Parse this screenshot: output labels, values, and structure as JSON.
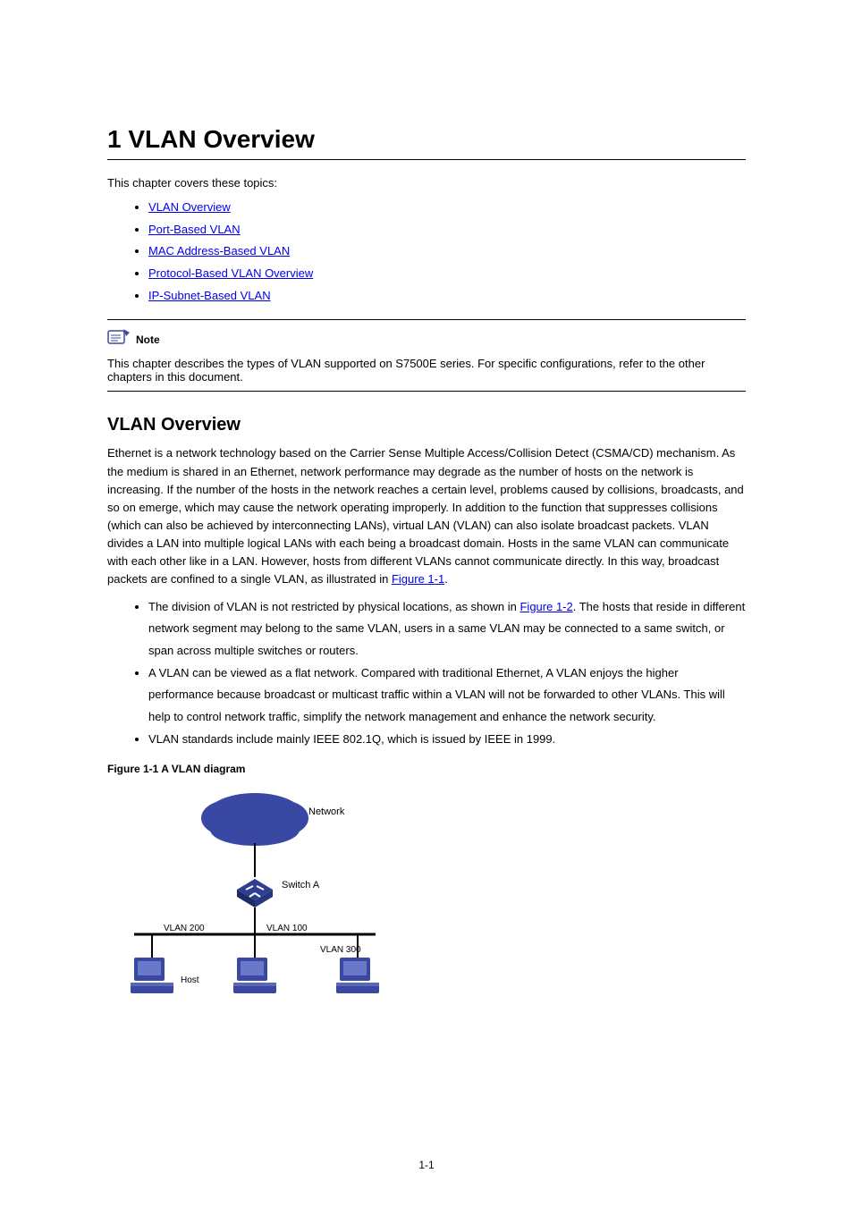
{
  "chapter": {
    "number": "1",
    "title": "VLAN Overview"
  },
  "intro": "This chapter covers these topics:",
  "toc": [
    {
      "label": "VLAN Overview"
    },
    {
      "label": "Port-Based VLAN"
    },
    {
      "label": "MAC Address-Based VLAN"
    },
    {
      "label": "Protocol-Based VLAN Overview"
    },
    {
      "label": "IP-Subnet-Based VLAN"
    }
  ],
  "note": {
    "label": "Note",
    "text": "This chapter describes the types of VLAN supported on S7500E series. For specific configurations, refer to the other chapters in this document."
  },
  "section": {
    "title": "VLAN Overview"
  },
  "para1_a": "Ethernet is a network technology based on the Carrier Sense Multiple Access/Collision Detect (CSMA/CD) mechanism. As the medium is shared in an Ethernet, network performance may degrade as the number of hosts on the network is increasing. If the number of the hosts in the network reaches a certain level, problems caused by collisions, broadcasts, and so on emerge, which may cause the network operating improperly. In addition to the function that suppresses collisions (which can also be achieved by interconnecting LANs), virtual LAN (VLAN) can also isolate broadcast packets. VLAN divides a LAN into multiple logical LANs with each being a broadcast domain. Hosts in the same VLAN can communicate with each other like in a LAN. However, hosts from different VLANs cannot communicate directly. In this way, broadcast packets are confined to a single VLAN, as illustrated in ",
  "para1_link": "Figure 1-1",
  "para1_b": ".",
  "bullets2": [
    {
      "a": "The division of VLAN is not restricted by physical locations, as shown in ",
      "link": "Figure 1-2",
      "b": ". The hosts that reside in different network segment may belong to the same VLAN, users in a same VLAN may be connected to a same switch, or span across multiple switches or routers."
    },
    {
      "text": "A VLAN can be viewed as a flat network. Compared with traditional Ethernet, A VLAN enjoys the higher performance because broadcast or multicast traffic within a VLAN will not be forwarded to other VLANs. This will help to control network traffic, simplify the network management and enhance the network security."
    },
    {
      "text": "VLAN standards include mainly IEEE 802.1Q, which is issued by IEEE in 1999."
    }
  ],
  "figure": {
    "caption": "Figure 1-1 A VLAN diagram",
    "labels": {
      "network": "Network",
      "switch": "Switch A",
      "v200": "VLAN 200",
      "v100": "VLAN 100",
      "v300": "VLAN 300",
      "host": "Host"
    }
  },
  "page_number": "1-1"
}
